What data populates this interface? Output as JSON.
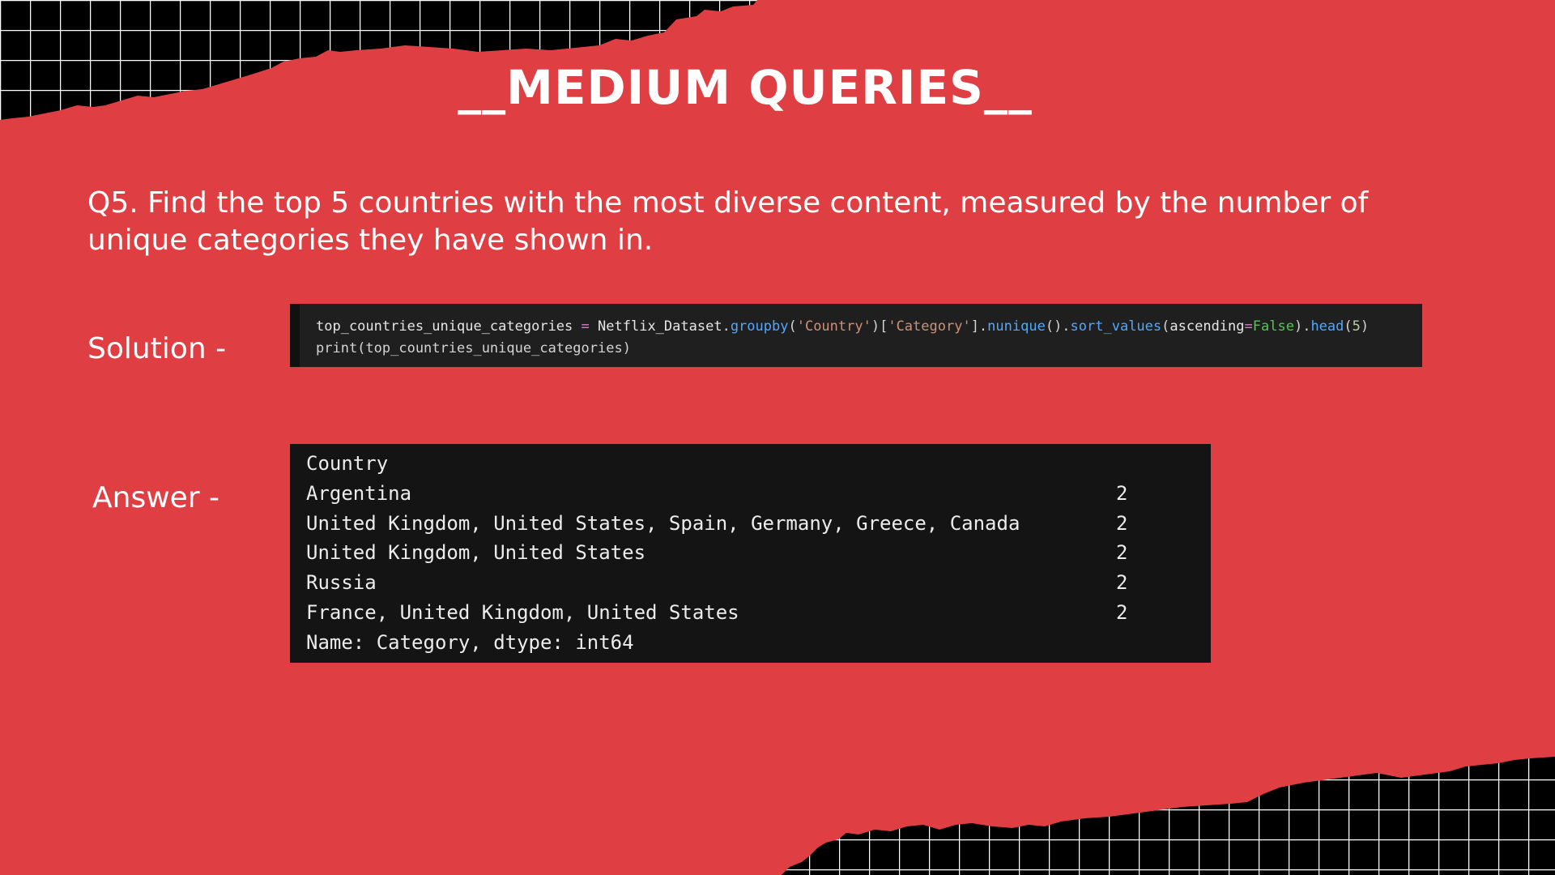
{
  "slide": {
    "title": "__MEDIUM QUERIES__",
    "question": "Q5. Find the top 5 countries with the most diverse content, measured by the number of unique categories they have shown in.",
    "solution_label": "Solution -",
    "answer_label": "Answer -"
  },
  "code": {
    "line1": {
      "var": "top_countries_unique_categories",
      "eq": "=",
      "obj": "Netflix_Dataset",
      "fn1": "groupby",
      "arg1": "'Country'",
      "arg2": "'Category'",
      "fn2": "nunique",
      "fn3": "sort_values",
      "param": "ascending",
      "kw": "False",
      "fn4": "head",
      "num": "5"
    },
    "line2": "print(top_countries_unique_categories)"
  },
  "output": {
    "header": "Country",
    "rows": [
      {
        "country": "Argentina",
        "count": "2"
      },
      {
        "country": "United Kingdom, United States, Spain, Germany, Greece, Canada",
        "count": "2"
      },
      {
        "country": "United Kingdom, United States",
        "count": "2"
      },
      {
        "country": "Russia",
        "count": "2"
      },
      {
        "country": "France, United Kingdom, United States",
        "count": "2"
      }
    ],
    "footer": "Name: Category, dtype: int64"
  },
  "colors": {
    "background": "#df3f42",
    "grid_background": "#000000",
    "grid_lines": "#ffffff",
    "code_background": "#1f1f1f",
    "output_background": "#141414",
    "function": "#4fa8ff",
    "string": "#ce9178",
    "keyword": "#4ec94e"
  }
}
